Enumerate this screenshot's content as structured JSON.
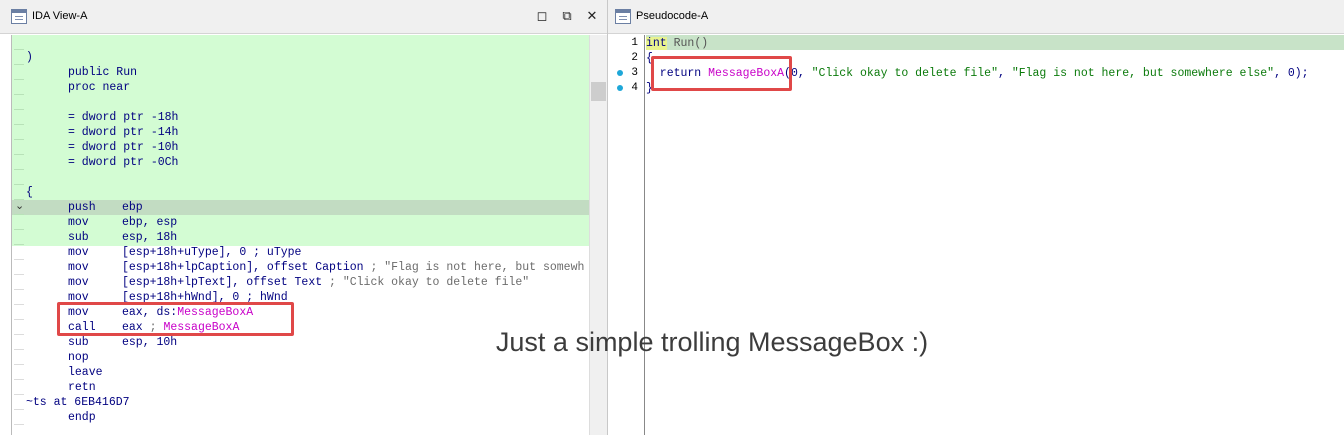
{
  "ida_view": {
    "title": "IDA View-A",
    "lines": [
      {
        "c1": ")",
        "c2": "",
        "c3": "",
        "cmt": "",
        "indent": true
      },
      {
        "c1": "",
        "c2": "public Run",
        "c3": "",
        "cmt": ""
      },
      {
        "c1": "",
        "c2": "proc near",
        "c3": "",
        "cmt": ""
      },
      {
        "c1": "",
        "c2": "",
        "c3": "",
        "cmt": ""
      },
      {
        "c1": "",
        "c2": "= dword ptr -18h",
        "c3": "",
        "cmt": ""
      },
      {
        "c1": "",
        "c2": "= dword ptr -14h",
        "c3": "",
        "cmt": ""
      },
      {
        "c1": "",
        "c2": "= dword ptr -10h",
        "c3": "",
        "cmt": ""
      },
      {
        "c1": "",
        "c2": "= dword ptr -0Ch",
        "c3": "",
        "cmt": ""
      },
      {
        "c1": "",
        "c2": "",
        "c3": "",
        "cmt": ""
      },
      {
        "c1": "{",
        "c2": "",
        "c3": "",
        "cmt": ""
      },
      {
        "c1": "",
        "c2": "push",
        "c3": "ebp",
        "cmt": ""
      },
      {
        "c1": "",
        "c2": "mov",
        "c3": "ebp, esp",
        "cmt": ""
      },
      {
        "c1": "",
        "c2": "sub",
        "c3": "esp, 18h",
        "cmt": ""
      },
      {
        "c1": "",
        "c2": "mov",
        "c3": "[esp+18h+uType], 0 ; uType",
        "cmt": ""
      },
      {
        "c1": "",
        "c2": "mov",
        "c3": "[esp+18h+lpCaption], offset Caption",
        "cmt": " ; \"Flag is not here, but somewh"
      },
      {
        "c1": "",
        "c2": "mov",
        "c3": "[esp+18h+lpText], offset Text",
        "cmt": " ; \"Click okay to delete file\""
      },
      {
        "c1": "",
        "c2": "mov",
        "c3": "[esp+18h+hWnd], 0 ; hWnd",
        "cmt": ""
      },
      {
        "c1": "",
        "c2": "mov",
        "c3": "eax, ds:",
        "mg": "MessageBoxA",
        "cmt": ""
      },
      {
        "c1": "",
        "c2": "call",
        "c3": "eax",
        "cmt": " ; ",
        "mg2": "MessageBoxA"
      },
      {
        "c1": "",
        "c2": "sub",
        "c3": "esp, 10h",
        "cmt": ""
      },
      {
        "c1": "",
        "c2": "nop",
        "c3": "",
        "cmt": ""
      },
      {
        "c1": "",
        "c2": "leave",
        "c3": "",
        "cmt": ""
      },
      {
        "c1": "",
        "c2": "retn",
        "c3": "",
        "cmt": ""
      },
      {
        "c1": "~ts at 6EB416D7",
        "c2": "",
        "c3": "",
        "cmt": ""
      },
      {
        "c1": "",
        "c2": "endp",
        "c3": "",
        "cmt": ""
      }
    ]
  },
  "pseudocode": {
    "title": "Pseudocode-A",
    "line_numbers": [
      "1",
      "2",
      "3",
      "4"
    ],
    "line1_type": "int",
    "line1_rest": " Run()",
    "line2": "{",
    "line3_kw": "  return ",
    "line3_fn": "MessageBoxA",
    "line3_args_a": "(0, ",
    "line3_str1": "\"Click okay to delete file\"",
    "line3_mid": ", ",
    "line3_str2": "\"Flag is not here, but somewhere else\"",
    "line3_end": ", 0);",
    "line4": "}"
  },
  "caption": "Just a simple trolling MessageBox :)",
  "colors": {
    "graph_bg": "#d3fcd3",
    "highlight_box": "#e04848",
    "api_name": "#c800c8",
    "string_literal": "#0b7a0b"
  },
  "icons": {
    "ida_title": "document-view-icon",
    "pseudo_title": "document-view-icon",
    "maximize": "maximize-icon",
    "restore": "restore-icon",
    "close": "close-icon"
  }
}
